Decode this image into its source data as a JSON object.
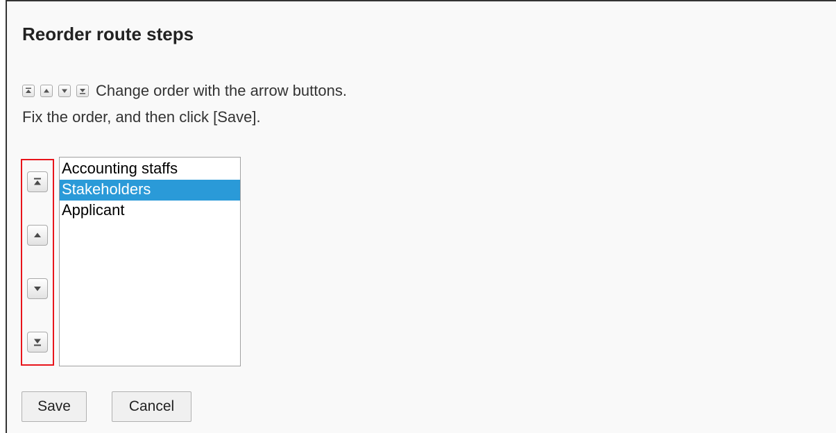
{
  "dialog": {
    "title": "Reorder route steps",
    "instruction_line1": "Change order with the arrow buttons.",
    "instruction_line2": "Fix the order, and then click [Save]."
  },
  "icons": {
    "top": "move-top-icon",
    "up": "move-up-icon",
    "down": "move-down-icon",
    "bottom": "move-bottom-icon"
  },
  "list": {
    "items": [
      {
        "label": "Accounting staffs",
        "selected": false
      },
      {
        "label": "Stakeholders",
        "selected": true
      },
      {
        "label": "Applicant",
        "selected": false
      }
    ]
  },
  "buttons": {
    "save": "Save",
    "cancel": "Cancel"
  },
  "colors": {
    "selection": "#2a9ad8",
    "highlight_border": "#e8141b"
  }
}
